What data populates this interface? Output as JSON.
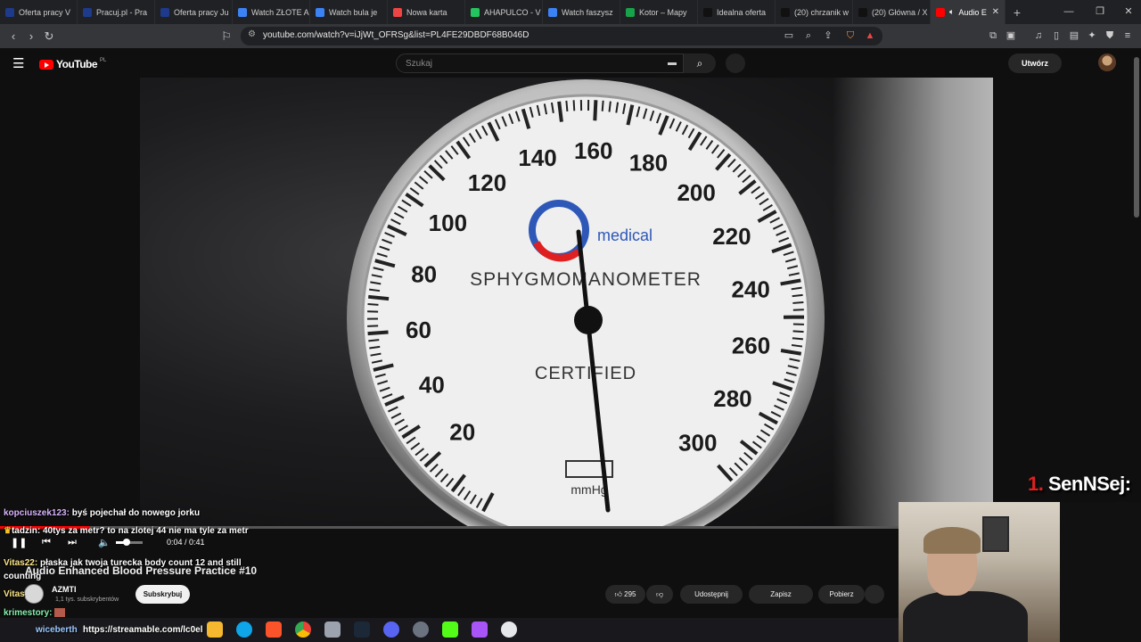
{
  "browser": {
    "tabs": [
      {
        "label": "Oferta pracy V",
        "color": "#1e3a8a"
      },
      {
        "label": "Pracuj.pl - Pra",
        "color": "#1e3a8a"
      },
      {
        "label": "Oferta pracy Ju",
        "color": "#1e3a8a"
      },
      {
        "label": "Watch ZŁOTE A",
        "color": "#3b82f6"
      },
      {
        "label": "Watch bula je",
        "color": "#3b82f6"
      },
      {
        "label": "Nowa karta",
        "color": "#ef4444"
      },
      {
        "label": "AHAPULCO - V",
        "color": "#22c55e"
      },
      {
        "label": "Watch faszysz",
        "color": "#3b82f6"
      },
      {
        "label": "Kotor – Mapy",
        "color": "#16a34a"
      },
      {
        "label": "Idealna oferta",
        "color": "#111111"
      },
      {
        "label": "(20) chrzanik w",
        "color": "#111111"
      },
      {
        "label": "(20) Główna / X",
        "color": "#111111"
      }
    ],
    "active_tab": {
      "label": "Audio E",
      "color": "#ff0000"
    },
    "url": "youtube.com/watch?v=iJjWt_OFRSg&list=PL4FE29DBDF68B046D"
  },
  "youtube": {
    "logo_text": "YouTube",
    "country": "PL",
    "search_placeholder": "Szukaj",
    "create_label": "Utwórz"
  },
  "video": {
    "gauge_brand": "medical",
    "gauge_title": "SPHYGMOMANOMETER",
    "gauge_certified": "CERTIFIED",
    "gauge_unit": "mmHg",
    "gauge_labels": [
      "20",
      "40",
      "60",
      "80",
      "100",
      "120",
      "140",
      "160",
      "180",
      "200",
      "220",
      "240",
      "260",
      "280",
      "300"
    ],
    "time_display": "0:04 / 0:41",
    "progress_fraction": 0.1,
    "volume_fraction": 0.35,
    "title": "Audio Enhanced Blood Pressure Practice #10",
    "channel_name": "AZMTI",
    "channel_subs": "1,1 tys. subskrybentów",
    "subscribe_label": "Subskrybuj",
    "like_count": "295",
    "share_label": "Udostępnij",
    "save_label": "Zapisz",
    "download_label": "Pobierz"
  },
  "chat": [
    {
      "user": "kopciuszek123:",
      "user_color": "#d8b4fe",
      "text": "byś pojechał do nowego jorku"
    },
    {
      "user": "tadzin:",
      "user_color": "#ffffff",
      "text": "40tys za metr? to na zlotej 44 nie ma tyle za metr"
    },
    {
      "user": "Vitas22:",
      "user_color": "#fde68a",
      "text": "płaska jak twoja turecka body count 12 and still"
    },
    {
      "user": "",
      "user_color": "#ffffff",
      "text": "counting"
    },
    {
      "user": "Vitas",
      "user_color": "#fde68a",
      "text": ""
    },
    {
      "user": "krimestory:",
      "user_color": "#86efac",
      "text": ""
    }
  ],
  "chat_link_user": "wiceberth",
  "chat_link": "https://streamable.com/lc0el",
  "overlay": {
    "rank": "1.",
    "streamer": "SenNSej:"
  },
  "colors": {
    "accent": "#ff0000",
    "bg": "#0f0f0f"
  }
}
